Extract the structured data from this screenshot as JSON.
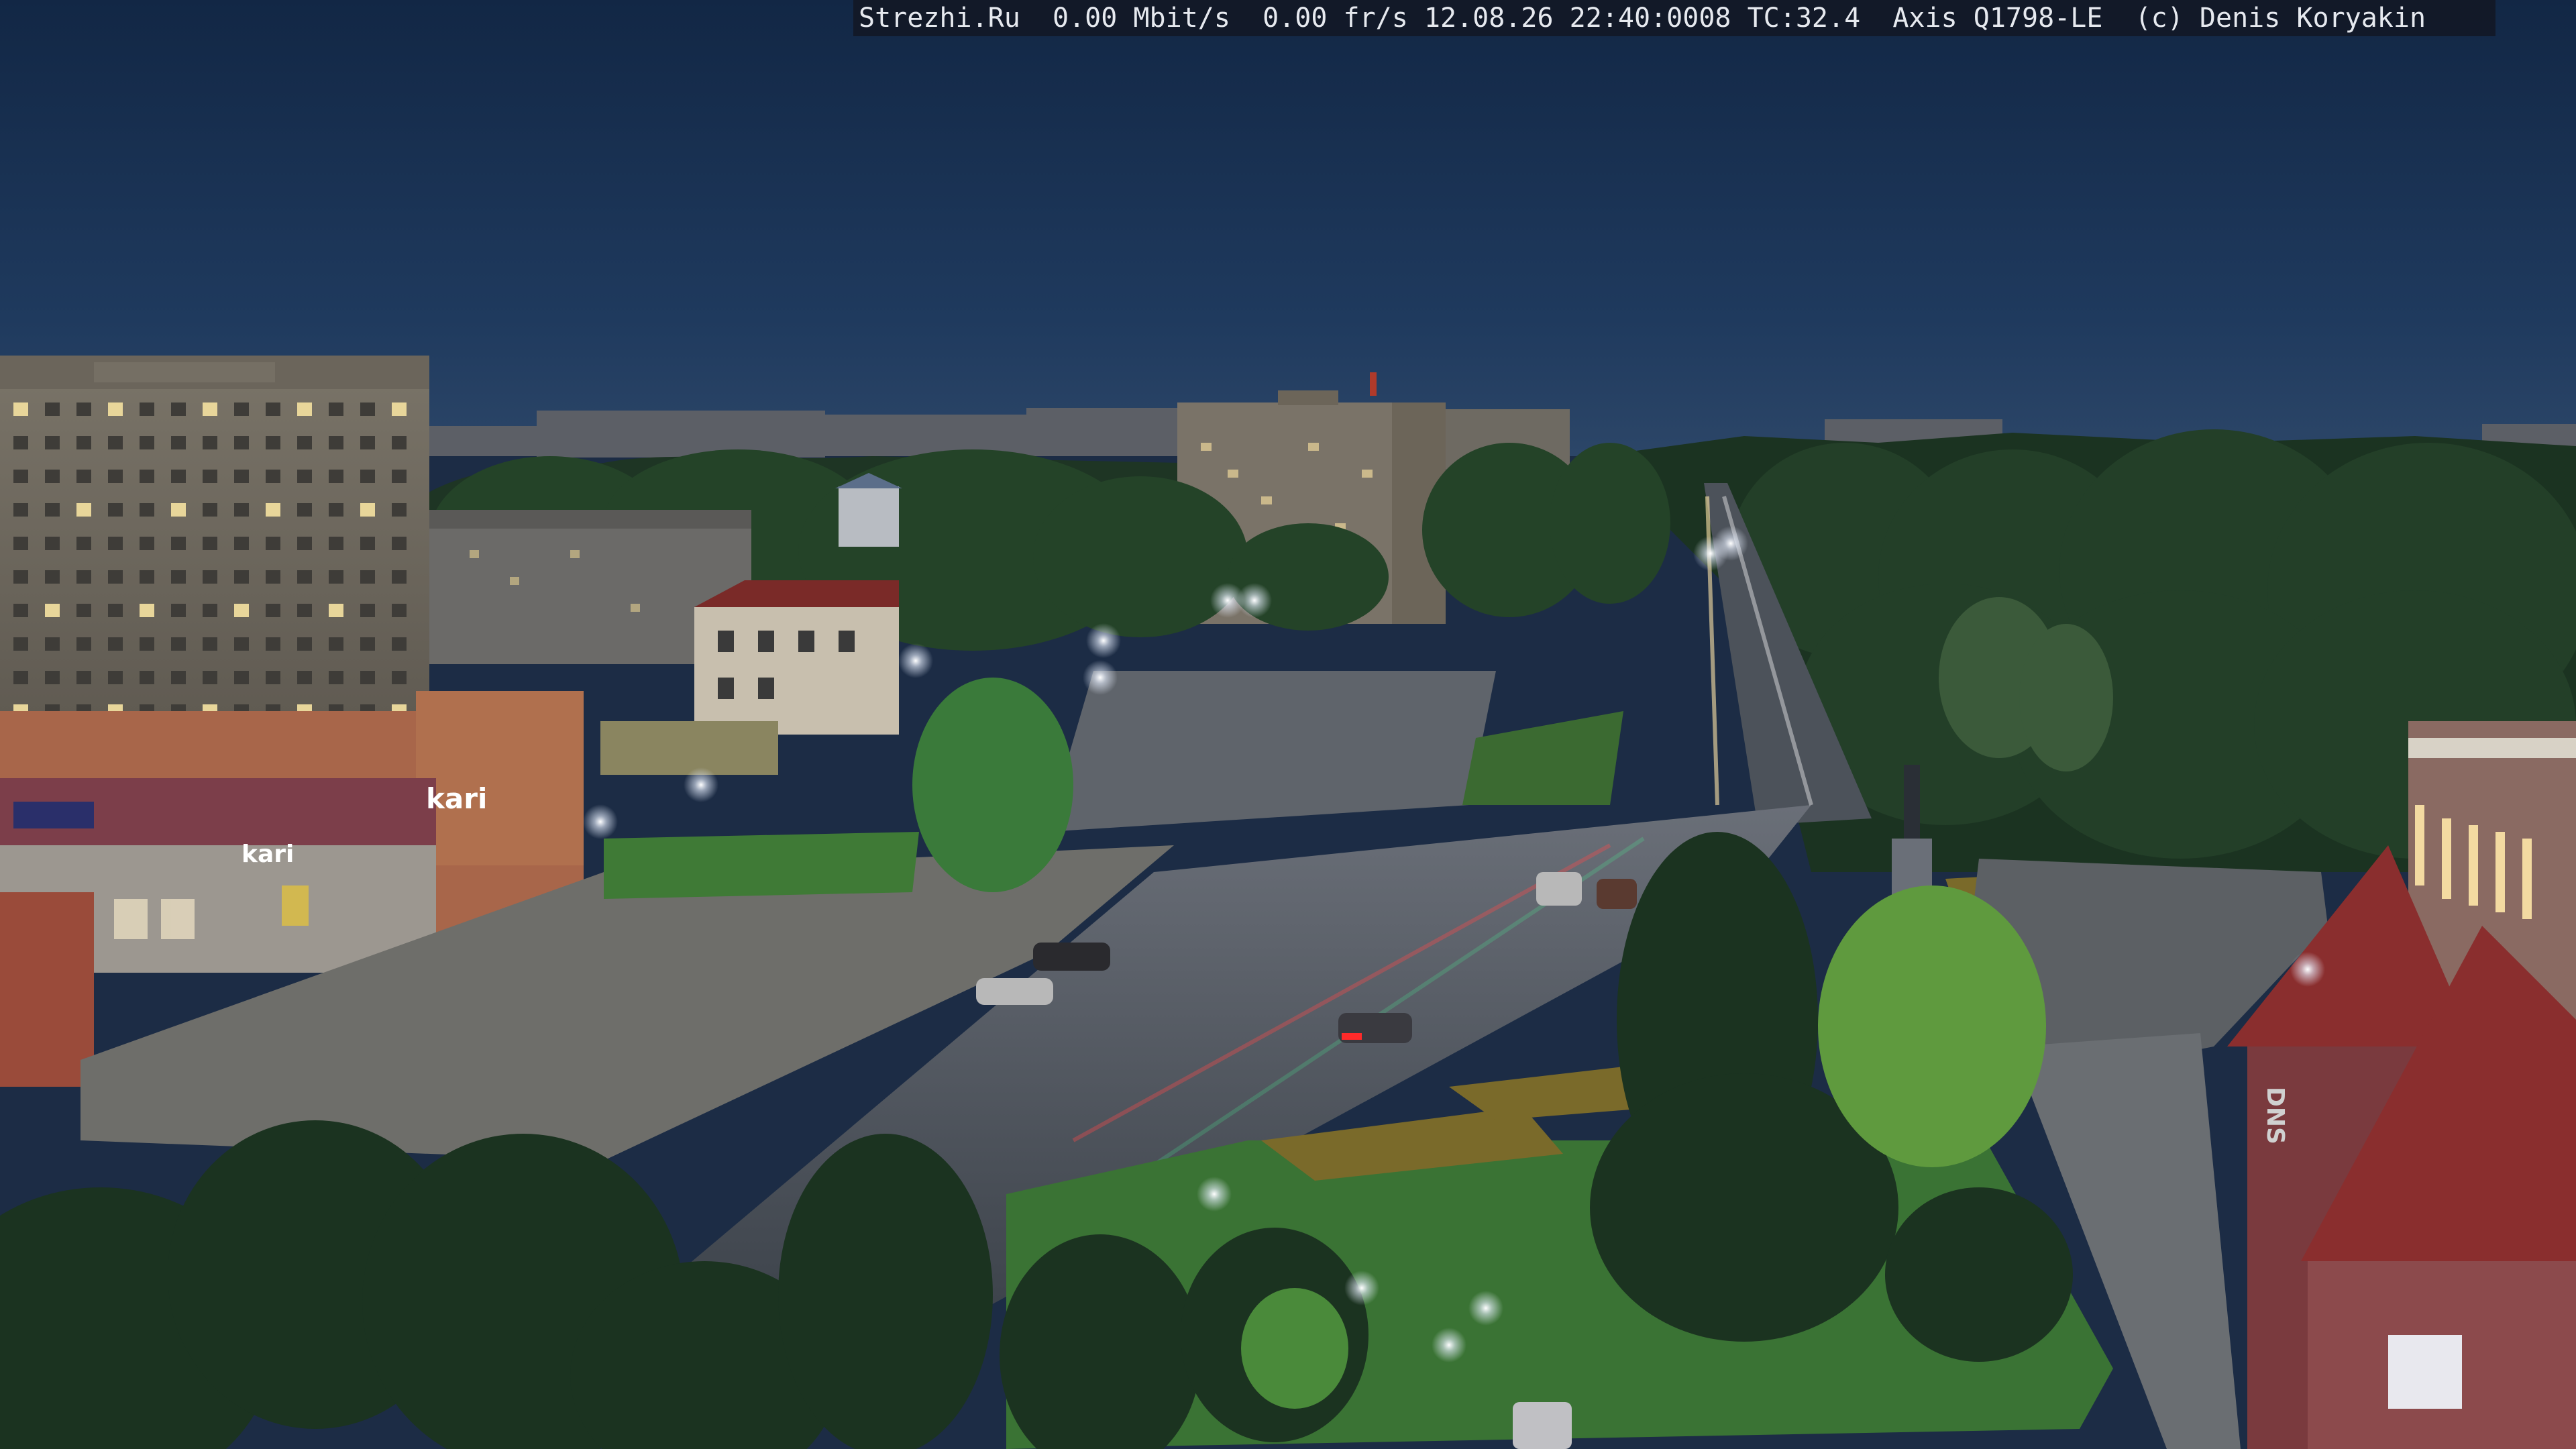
{
  "overlay": {
    "site": "Strezhi.Ru",
    "bitrate": "0.00 Mbit/s",
    "framerate": "0.00 fr/s",
    "datetime": "12.08.26 22:40:0008",
    "tc": "TC:32.4",
    "camera": "Axis Q1798-LE",
    "copyright": "(c) Denis Koryakin"
  },
  "signs": {
    "kari_large": "kari",
    "kari_small": "kari",
    "dns": "DNS"
  },
  "colors": {
    "sky_top": "#13294a",
    "sky_horizon": "#2b4466",
    "trees": "#1f3a24",
    "road": "#4a5058",
    "grass": "#3f7a36"
  }
}
